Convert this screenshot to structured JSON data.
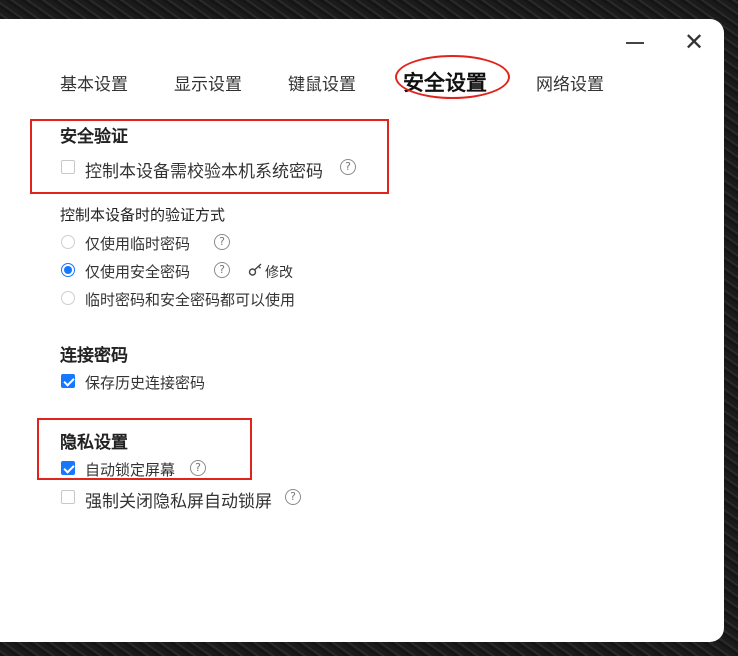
{
  "window": {
    "minimize_icon": "minimize-icon",
    "close_glyph": "✕"
  },
  "tabs": [
    {
      "label": "基本设置"
    },
    {
      "label": "显示设置"
    },
    {
      "label": "键鼠设置"
    },
    {
      "label": "安全设置",
      "active": true
    },
    {
      "label": "网络设置"
    }
  ],
  "security_verification": {
    "title": "安全验证",
    "option_label": "控制本设备需校验本机系统密码",
    "checked": false
  },
  "verify_method": {
    "title": "控制本设备时的验证方式",
    "options": [
      {
        "label": "仅使用临时密码",
        "selected": false
      },
      {
        "label": "仅使用安全密码",
        "selected": true
      },
      {
        "label": "临时密码和安全密码都可以使用",
        "selected": false
      }
    ],
    "modify_label": "修改"
  },
  "connection_password": {
    "title": "连接密码",
    "option_label": "保存历史连接密码",
    "checked": true
  },
  "privacy": {
    "title": "隐私设置",
    "options": [
      {
        "label": "自动锁定屏幕",
        "checked": true
      },
      {
        "label": "强制关闭隐私屏自动锁屏",
        "checked": false
      }
    ]
  },
  "help_glyph": "?",
  "colors": {
    "accent": "#1677ff",
    "annotation_red": "#e0241b"
  }
}
